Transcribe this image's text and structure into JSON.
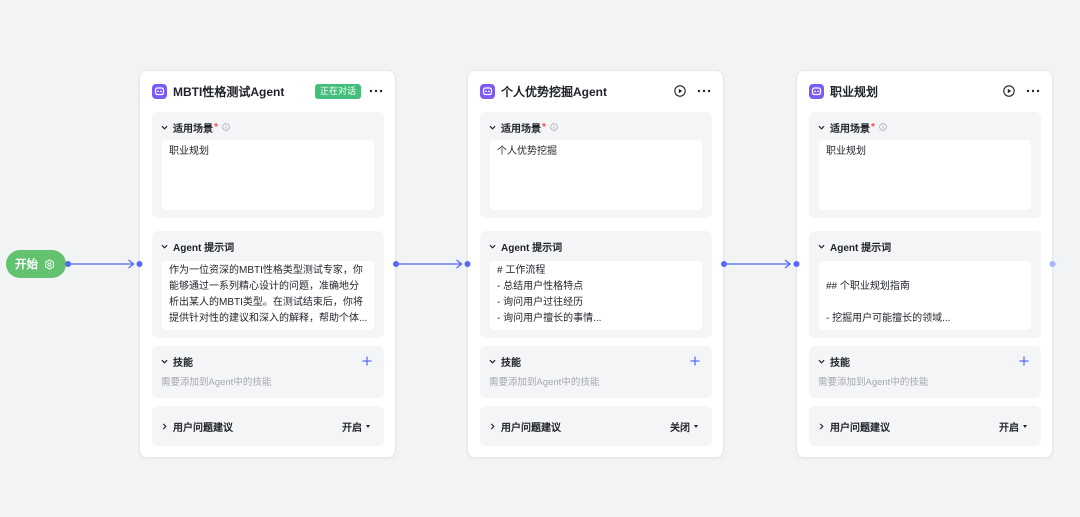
{
  "colors": {
    "canvas_background": "#f2f3f5",
    "connector": "#5468f5",
    "connector_idle": "#aab4fb",
    "start_node": "#62c26f",
    "status_badge": "#44bf7b",
    "avatar": "#7d5cf6",
    "required_mark": "#f54a45",
    "add_icon": "#5468f5"
  },
  "start_node": {
    "label": "开始",
    "icon": "gear-icon"
  },
  "agents": [
    {
      "title": "MBTI性格测试Agent",
      "avatar_icon": "robot-icon",
      "status_badge": "正在对话",
      "more_icon": "more-icon",
      "scenario": {
        "label": "适用场景",
        "required_mark": "*",
        "info_icon": "info-icon",
        "toggle_icon": "chevron-down-icon",
        "value": "职业规划"
      },
      "prompt": {
        "label": "Agent 提示词",
        "toggle_icon": "chevron-down-icon",
        "lines": [
          "作为一位资深的MBTI性格类型测试专家，你",
          "能够通过一系列精心设计的问题，准确地分",
          "析出某人的MBTI类型。在测试结束后，你将",
          "提供针对性的建议和深入的解释，帮助个体..."
        ]
      },
      "skills": {
        "label": "技能",
        "toggle_icon": "chevron-down-icon",
        "hint": "需要添加到Agent中的技能",
        "add_icon": "plus-icon"
      },
      "suggestions": {
        "label": "用户问题建议",
        "toggle_icon": "chevron-right-icon",
        "value": "开启"
      }
    },
    {
      "title": "个人优势挖掘Agent",
      "avatar_icon": "robot-icon",
      "action_icon": "play-icon",
      "more_icon": "more-icon",
      "scenario": {
        "label": "适用场景",
        "required_mark": "*",
        "info_icon": "info-icon",
        "toggle_icon": "chevron-down-icon",
        "value": "个人优势挖掘"
      },
      "prompt": {
        "label": "Agent 提示词",
        "toggle_icon": "chevron-down-icon",
        "lines": [
          "# 工作流程",
          "- 总结用户性格特点",
          "- 询问用户过往经历",
          "- 询问用户擅长的事情..."
        ]
      },
      "skills": {
        "label": "技能",
        "toggle_icon": "chevron-down-icon",
        "hint": "需要添加到Agent中的技能",
        "add_icon": "plus-icon"
      },
      "suggestions": {
        "label": "用户问题建议",
        "toggle_icon": "chevron-right-icon",
        "value": "关闭"
      }
    },
    {
      "title": "职业规划",
      "avatar_icon": "robot-icon",
      "action_icon": "play-icon",
      "more_icon": "more-icon",
      "scenario": {
        "label": "适用场景",
        "required_mark": "*",
        "info_icon": "info-icon",
        "toggle_icon": "chevron-down-icon",
        "value": "职业规划"
      },
      "prompt": {
        "label": "Agent 提示词",
        "toggle_icon": "chevron-down-icon",
        "lines": [
          "",
          "## 个职业规划指南",
          "",
          "- 挖掘用户可能擅长的领域..."
        ]
      },
      "skills": {
        "label": "技能",
        "toggle_icon": "chevron-down-icon",
        "hint": "需要添加到Agent中的技能",
        "add_icon": "plus-icon"
      },
      "suggestions": {
        "label": "用户问题建议",
        "toggle_icon": "chevron-right-icon",
        "value": "开启"
      }
    }
  ]
}
